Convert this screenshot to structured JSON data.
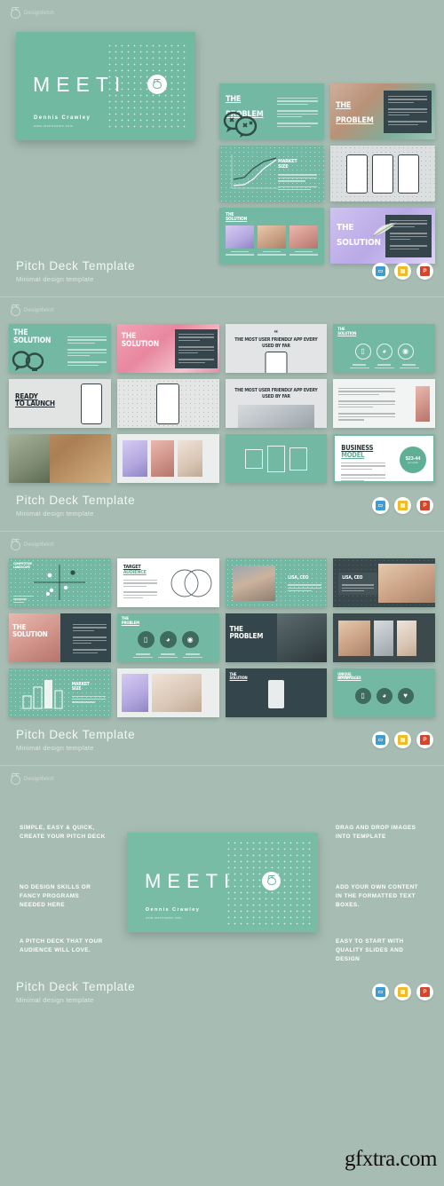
{
  "brand": {
    "name": "Designfetch",
    "mark": "cat-logo-icon"
  },
  "product": {
    "title": "Pitch Deck Template",
    "subtitle": "Minimal design template"
  },
  "formats": [
    {
      "name": "keynote-icon",
      "label": "KEY",
      "color": "#3b9dd6"
    },
    {
      "name": "google-slides-icon",
      "label": "S",
      "color": "#f0bb24"
    },
    {
      "name": "powerpoint-icon",
      "label": "P",
      "color": "#d5452c"
    }
  ],
  "hero": {
    "title": "MEETI",
    "author": "Dennis Crawley",
    "site": "www.meetiname.com"
  },
  "sections": [
    {
      "id": "section-1",
      "title": "Pitch Deck Template",
      "subtitle": "Minimal design template"
    },
    {
      "id": "section-2",
      "title": "Pitch Deck Template",
      "subtitle": "Minimal design template"
    },
    {
      "id": "section-3",
      "title": "Pitch Deck Template",
      "subtitle": "Minimal design template"
    },
    {
      "id": "section-4",
      "title": "Pitch Deck Template",
      "subtitle": "Minimal design template"
    }
  ],
  "slides": {
    "s1": [
      {
        "name": "slide-the-problem-icon",
        "title": "THE PROBLEM"
      },
      {
        "name": "slide-the-problem-photo",
        "title": "THE PROBLEM"
      },
      {
        "name": "slide-market-size-line",
        "title": "MARKET SIZE"
      },
      {
        "name": "slide-phone-mockups",
        "title": ""
      },
      {
        "name": "slide-the-solution-three-photos",
        "title": "THE SOLUTION"
      },
      {
        "name": "slide-the-solution-purple",
        "title": "THE SOLUTION"
      }
    ],
    "s2": [
      {
        "name": "slide-the-solution-bulb",
        "title": "THE SOLUTION"
      },
      {
        "name": "slide-the-solution-pink",
        "title": "THE SOLUTION"
      },
      {
        "name": "slide-quote-mobile",
        "title": "THE MOST USER FRIENDLY APP EVERY USED BY FAR"
      },
      {
        "name": "slide-the-solution-icons",
        "title": "THE SOLUTION"
      },
      {
        "name": "slide-ready-to-launch",
        "title": "READY TO LAUNCH"
      },
      {
        "name": "slide-phone-center",
        "title": ""
      },
      {
        "name": "slide-quote-laptop",
        "title": "THE MOST USER FRIENDLY APP EVERY USED BY FAR"
      },
      {
        "name": "slide-text-photo",
        "title": ""
      },
      {
        "name": "slide-cork-photo",
        "title": ""
      },
      {
        "name": "slide-product-trio",
        "title": ""
      },
      {
        "name": "slide-gallery-frames",
        "title": ""
      },
      {
        "name": "slide-business-model",
        "title": "BUSINESS MODEL",
        "badge": "$23-44",
        "badge_sub": "per month"
      }
    ],
    "s3": [
      {
        "name": "slide-competitive-landscape",
        "title": "COMPETITIVE LANDSCAPE"
      },
      {
        "name": "slide-target-audience",
        "title": "TARGET AUDIENCE"
      },
      {
        "name": "slide-lisa-ceo-light",
        "title": "LISA, CEO"
      },
      {
        "name": "slide-lisa-ceo-dark",
        "title": "LISA, CEO"
      },
      {
        "name": "slide-the-solution-hand",
        "title": "THE SOLUTION"
      },
      {
        "name": "slide-the-problem-icons",
        "title": "THE PROBLEM"
      },
      {
        "name": "slide-the-problem-photo-dark",
        "title": "THE PROBLEM"
      },
      {
        "name": "slide-team-gallery",
        "title": ""
      },
      {
        "name": "slide-market-size-bars",
        "title": "MARKET SIZE"
      },
      {
        "name": "slide-photo-duo",
        "title": ""
      },
      {
        "name": "slide-the-solution-phone",
        "title": "THE SOLUTION"
      },
      {
        "name": "slide-unique-advantages",
        "title": "UNIQUE ADVANTAGES"
      }
    ]
  },
  "features": {
    "left": [
      "SIMPLE, EASY & QUICK,\nCREATE YOUR PITCH DECK",
      "NO DESIGN SKILLS OR\nFANCY PROGRAMS\nNEEDED HERE",
      "A PITCH DECK THAT YOUR\nAUDIENCE WILL LOVE."
    ],
    "right": [
      "DRAG AND DROP IMAGES\nINTO TEMPLATE",
      "ADD YOUR OWN CONTENT\nIN THE FORMATTED TEXT\nBOXES.",
      "EASY TO START WITH\nQUALITY SLIDES AND\nDESIGN"
    ]
  },
  "watermark": "gfxtra.com",
  "colors": {
    "page_bg": "#a7bdb3",
    "mint": "#72b8a2",
    "dark": "#34464b",
    "pink": "#e8879f",
    "purple": "#c4b6ec",
    "light": "#e7e9e8"
  }
}
